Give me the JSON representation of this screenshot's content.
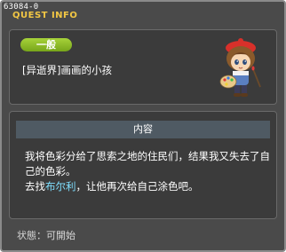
{
  "window": {
    "quest_id": "63084-0",
    "title": "QUEST INFO"
  },
  "quest": {
    "category": "一般",
    "name": "[异逝界]画画的小孩"
  },
  "content": {
    "header": "内容",
    "line1": "我将色彩分给了思索之地的住民们，结果我又失去了自己的色彩。",
    "line2_before": "去找",
    "npc_name": "布尔利",
    "line2_after": "，让他再次给自己涂色吧。"
  },
  "status": {
    "text": "状態：可開始"
  },
  "colors": {
    "title": "#f2c744",
    "category_badge": "#8fbe28",
    "npc_highlight": "#7fe0ff"
  }
}
